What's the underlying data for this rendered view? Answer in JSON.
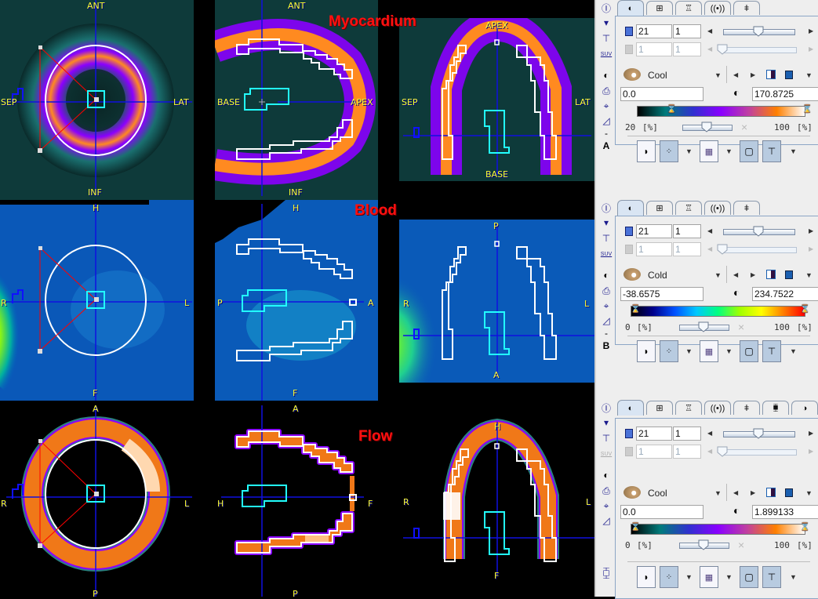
{
  "rows": [
    {
      "title": "Myocardium",
      "views": [
        {
          "name": "short-axis",
          "labels": {
            "top": "ANT",
            "bottom": "INF",
            "left": "SEP",
            "right": "LAT"
          }
        },
        {
          "name": "horizontal-long-axis",
          "labels": {
            "top": "ANT",
            "bottom": "INF",
            "left": "BASE",
            "right": "APEX"
          }
        },
        {
          "name": "vertical-long-axis",
          "labels": {
            "top": "APEX",
            "bottom": "BASE",
            "left": "SEP",
            "right": "LAT"
          }
        }
      ],
      "colormap_colors": [
        "#000000",
        "#007b7b",
        "#3030d0",
        "#8a00ff",
        "#c040a0",
        "#ff8000",
        "#ffffff"
      ]
    },
    {
      "title": "Blood",
      "views": [
        {
          "name": "transaxial",
          "labels": {
            "top": "H",
            "bottom": "F",
            "left": "R",
            "right": "L"
          }
        },
        {
          "name": "sagittal",
          "labels": {
            "top": "H",
            "bottom": "F",
            "left": "P",
            "right": "A"
          }
        },
        {
          "name": "coronal",
          "labels": {
            "top": "P",
            "bottom": "A",
            "left": "R",
            "right": "L"
          }
        }
      ],
      "colormap_colors": [
        "#000000",
        "#00008b",
        "#0050ff",
        "#00c8ff",
        "#00ff80",
        "#a0ff00",
        "#ffff00",
        "#ff8000",
        "#ff0000"
      ]
    },
    {
      "title": "Flow",
      "views": [
        {
          "name": "transaxial",
          "labels": {
            "top": "A",
            "bottom": "P",
            "left": "R",
            "right": "L"
          }
        },
        {
          "name": "sagittal",
          "labels": {
            "top": "A",
            "bottom": "P",
            "left": "H",
            "right": "F"
          }
        },
        {
          "name": "coronal",
          "labels": {
            "top": "H",
            "bottom": "F",
            "left": "R",
            "right": "L"
          }
        }
      ],
      "colormap_colors": [
        "#000000",
        "#007b7b",
        "#3030d0",
        "#8a00ff",
        "#c040a0",
        "#ff8000",
        "#ffffff"
      ]
    }
  ],
  "panels": [
    {
      "id": "A",
      "tabs": [
        "◐",
        "⊞",
        "♖",
        "((•))",
        "ǂ"
      ],
      "slice": "21",
      "frame": "1",
      "slice2": "1",
      "frame2": "1",
      "colormap": "Cool",
      "min": "0.0",
      "max": "170.8725",
      "lower_pct": "20",
      "upper_pct": "100",
      "pct_unit": "[%]",
      "slice_slider": 0.5,
      "gamma_slider": 0.5,
      "letter": "A",
      "dash": "-"
    },
    {
      "id": "B",
      "tabs": [
        "◐",
        "⊞",
        "♖",
        "((•))",
        "ǂ"
      ],
      "slice": "21",
      "frame": "1",
      "slice2": "1",
      "frame2": "1",
      "colormap": "Cold",
      "min": "-38.6575",
      "max": "234.7522",
      "lower_pct": "0",
      "upper_pct": "100",
      "pct_unit": "[%]",
      "slice_slider": 0.5,
      "gamma_slider": 0.5,
      "letter": "B",
      "dash": "-"
    },
    {
      "id": "C",
      "tabs": [
        "◐",
        "⊞",
        "♖",
        "((•))",
        "ǂ",
        "⧯",
        "◑"
      ],
      "slice": "21",
      "frame": "1",
      "slice2": "1",
      "frame2": "1",
      "colormap": "Cool",
      "min": "0.0",
      "max": "1.899133",
      "lower_pct": "0",
      "upper_pct": "100",
      "pct_unit": "[%]",
      "slice_slider": 0.5,
      "gamma_slider": 0.5
    }
  ],
  "sidebar_icons": [
    "info-icon",
    "dropdown-icon",
    "network-icon",
    "suv-icon",
    "contrast-icon",
    "print-icon",
    "crosshair-icon",
    "histogram-icon"
  ],
  "suv_label": "SUV"
}
